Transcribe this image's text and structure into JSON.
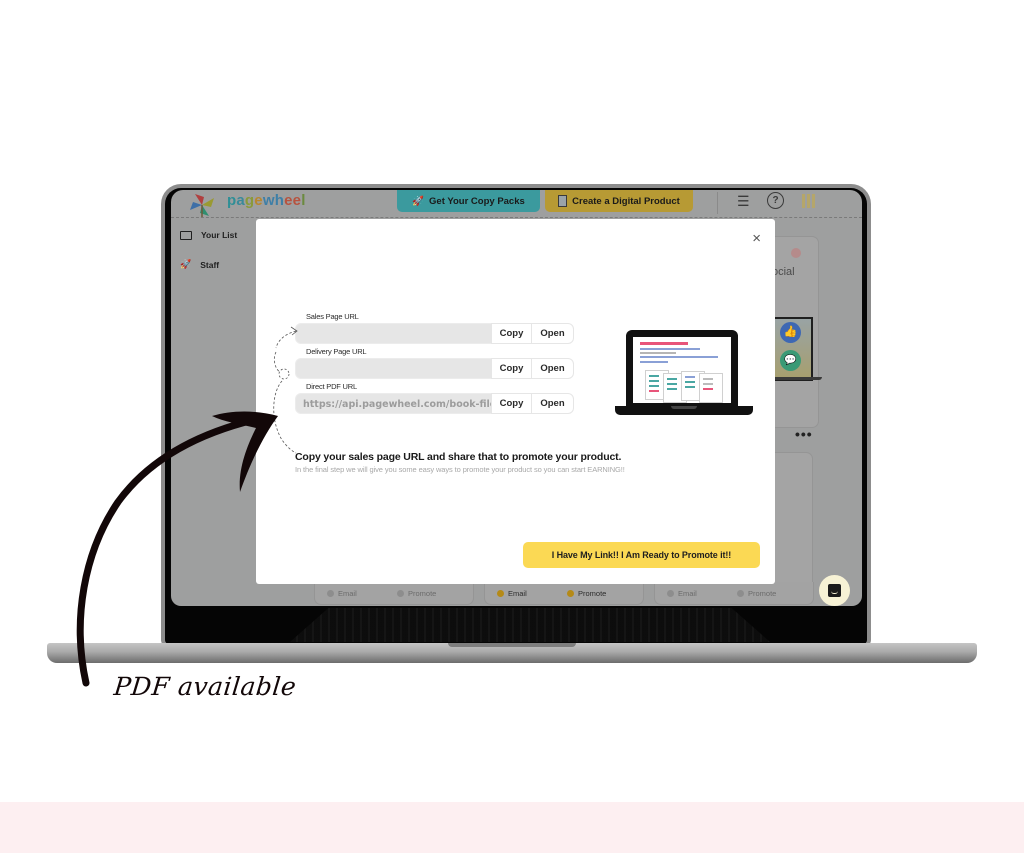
{
  "app": {
    "brand_letters": [
      "p",
      "a",
      "g",
      "e",
      "w",
      "h",
      "e",
      "e",
      "l"
    ],
    "topbar": {
      "copy_packs_label": "Get Your Copy Packs",
      "create_product_label": "Create a Digital Product",
      "icons": [
        "list-icon",
        "help-icon",
        "apps-icon"
      ]
    },
    "sidebar": {
      "items": [
        {
          "label": "Your List",
          "icon": "envelope-icon"
        },
        {
          "label": "Staff",
          "icon": "rocket-icon"
        }
      ]
    },
    "background_cards": {
      "social_text": "ocial",
      "more_label": "•••",
      "footers": [
        {
          "email": "Email",
          "promote": "Promote",
          "active": false
        },
        {
          "email": "Email",
          "promote": "Promote",
          "active": true
        },
        {
          "email": "Email",
          "promote": "Promote",
          "active": false
        }
      ]
    }
  },
  "modal": {
    "close_label": "×",
    "fields": [
      {
        "label": "Sales Page URL",
        "value": "",
        "copy_label": "Copy",
        "open_label": "Open"
      },
      {
        "label": "Delivery Page URL",
        "value": "",
        "copy_label": "Copy",
        "open_label": "Open"
      },
      {
        "label": "Direct PDF URL",
        "value": "https://api.pagewheel.com/book-file/",
        "copy_label": "Copy",
        "open_label": "Open"
      }
    ],
    "headline": "Copy your sales page URL and share that to promote your product.",
    "subline": "In the final step we will give you some easy ways to promote your product so you can start EARNING!!",
    "promote_button_label": "I Have My Link!! I Am Ready to Promote it!!"
  },
  "annotation": {
    "text": "PDF available"
  },
  "colors": {
    "copy_packs_button": "#3b9a9e",
    "create_product_button": "#b79a34",
    "promote_button": "#fbd954",
    "band": "#fdeff1",
    "arrow": "#120708"
  }
}
